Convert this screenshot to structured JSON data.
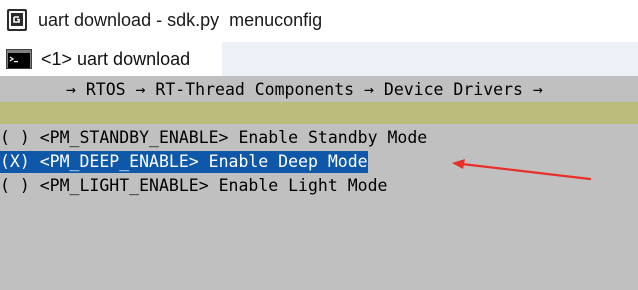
{
  "window": {
    "title": "uart download - sdk.py  menuconfig"
  },
  "tab": {
    "label": "<1> uart download"
  },
  "terminal": {
    "breadcrumb": "→ RTOS → RT-Thread Components → Device Drivers →",
    "options": [
      {
        "marker": "( )",
        "symbol": "<PM_STANDBY_ENABLE>",
        "description": "Enable Standby Mode",
        "selected": false
      },
      {
        "marker": "(X)",
        "symbol": "<PM_DEEP_ENABLE>",
        "description": "Enable Deep Mode",
        "selected": true
      },
      {
        "marker": "( )",
        "symbol": "<PM_LIGHT_ENABLE>",
        "description": "Enable Light Mode",
        "selected": false
      }
    ]
  },
  "colors": {
    "terminal_background": "#c0c0c0",
    "header_bar": "#bcbc7c",
    "selection_background": "#0f57a8",
    "selection_text": "#ffffff",
    "annotation_arrow": "#e8302a"
  },
  "icons": {
    "app": "console-app-icon",
    "tab": "terminal-icon",
    "annotation": "red-arrow-icon"
  }
}
